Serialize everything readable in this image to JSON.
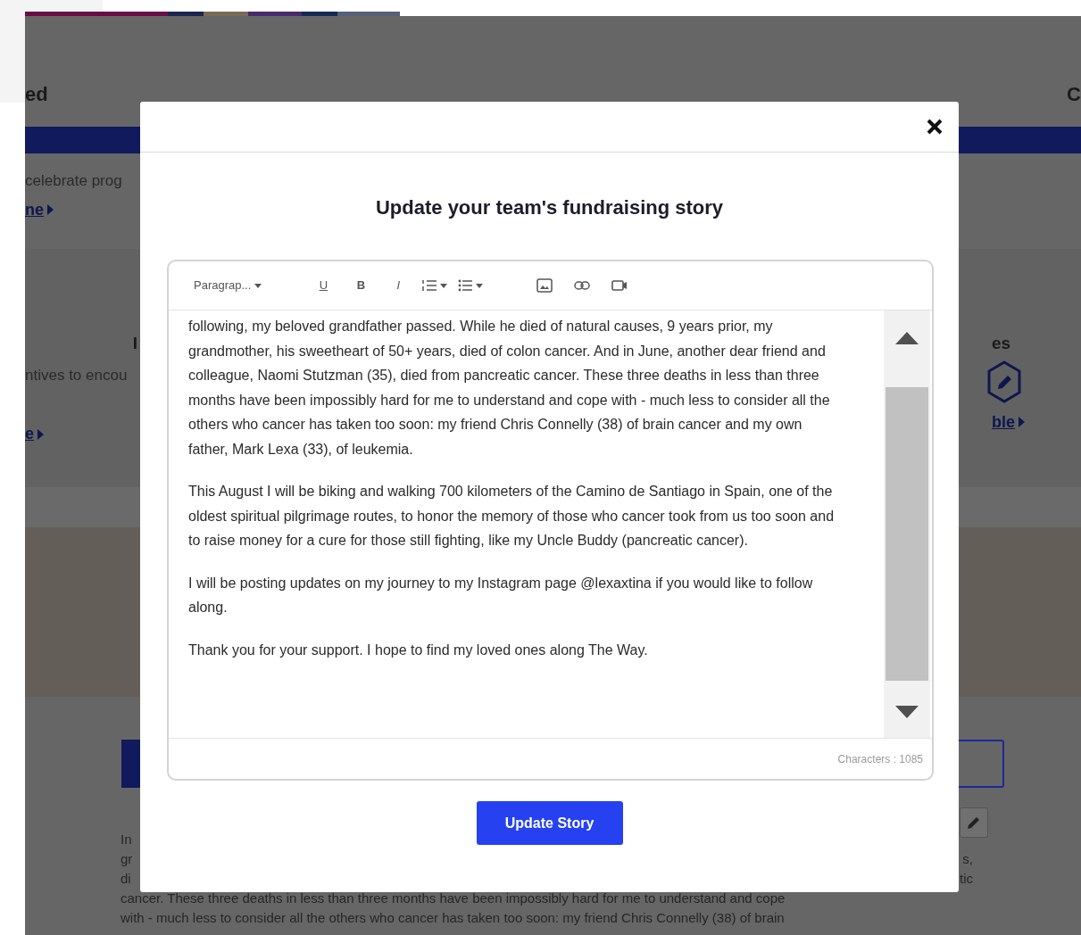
{
  "background": {
    "section_title": "ed",
    "section_title_right": "C",
    "intro_text": "celebrate prog",
    "intro_link": "ne",
    "cards": [
      {
        "title": "I",
        "text": "ntives to encou",
        "link": "e"
      },
      {
        "title": "es",
        "link": "ble"
      }
    ],
    "story_lines": [
      {
        "left": "In"
      },
      {
        "left": "gr",
        "right": "s,"
      },
      {
        "left": "di",
        "right": "tic"
      },
      {
        "left": "cancer. These three deaths in less than three months have been impossibly hard for me to understand and cope"
      },
      {
        "left": "with - much less to consider all the others who cancer has taken too soon: my friend Chris Connelly (38) of brain"
      }
    ]
  },
  "modal": {
    "title": "Update your team's fundraising story",
    "toolbar": {
      "format": "Paragrap...",
      "marks": [
        "U",
        "B",
        "I"
      ]
    },
    "paragraphs": [
      "following, my beloved grandfather passed. While he died of natural causes, 9 years prior, my grandmother, his sweetheart of 50+ years, died of colon cancer. And in June, another dear friend and colleague, Naomi Stutzman (35), died from pancreatic cancer. These three deaths in less than three months have been impossibly hard for me to understand and cope with - much less to consider all the others who cancer has taken too soon: my friend Chris Connelly (38) of brain cancer and my own father, Mark Lexa (33), of leukemia.",
      "This August I will be biking and walking 700 kilometers of the Camino de Santiago in Spain, one of the oldest spiritual pilgrimage routes, to honor the memory of those who cancer took from us too soon and to raise money for a cure for those still fighting, like my Uncle Buddy (pancreatic cancer).",
      "I will be posting updates on my journey to my Instagram page @lexaxtina if you would like to follow along.",
      "Thank you for your support. I hope to find my loved ones along The Way."
    ],
    "character_count": "Characters : 1085",
    "submit_button": "Update Story"
  }
}
